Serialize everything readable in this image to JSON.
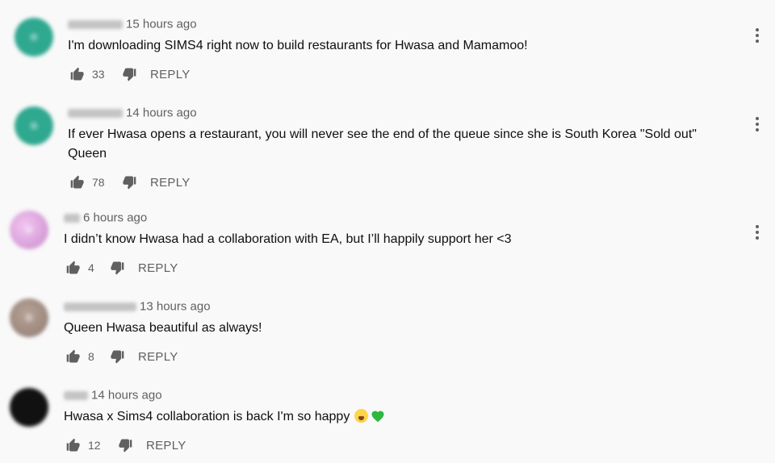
{
  "comments": [
    {
      "author_hidden": true,
      "time": "15 hours ago",
      "text": "I'm downloading SIMS4 right now to build restaurants for Hwasa and Mamamoo!",
      "likes": "33",
      "reply_label": "REPLY",
      "avatar_color": "#2fa890"
    },
    {
      "author_hidden": true,
      "time": "14 hours ago",
      "text": "If ever Hwasa opens a restaurant, you will never see the end of the queue since she is South Korea \"Sold out\" Queen",
      "likes": "78",
      "reply_label": "REPLY",
      "avatar_color": "#2fa890"
    },
    {
      "author_hidden": true,
      "time": "6 hours ago",
      "text": "I didn’t know Hwasa had a collaboration with EA, but I’ll happily support her <3",
      "likes": "4",
      "reply_label": "REPLY",
      "avatar_color": "#d9a2d9"
    },
    {
      "author_hidden": true,
      "time": "13 hours ago",
      "text": "Queen Hwasa beautiful as always!",
      "likes": "8",
      "reply_label": "REPLY",
      "avatar_color": "#a08a80"
    },
    {
      "author_hidden": true,
      "time": "14 hours ago",
      "text": "Hwasa x Sims4 collaboration is back I'm so happy",
      "emojis": [
        "crying-face",
        "green-heart"
      ],
      "likes": "12",
      "reply_label": "REPLY",
      "avatar_color": "#111111"
    }
  ],
  "colors": {
    "background": "#f9f9f9",
    "secondary_text": "#606060",
    "primary_text": "#0f0f0f"
  }
}
